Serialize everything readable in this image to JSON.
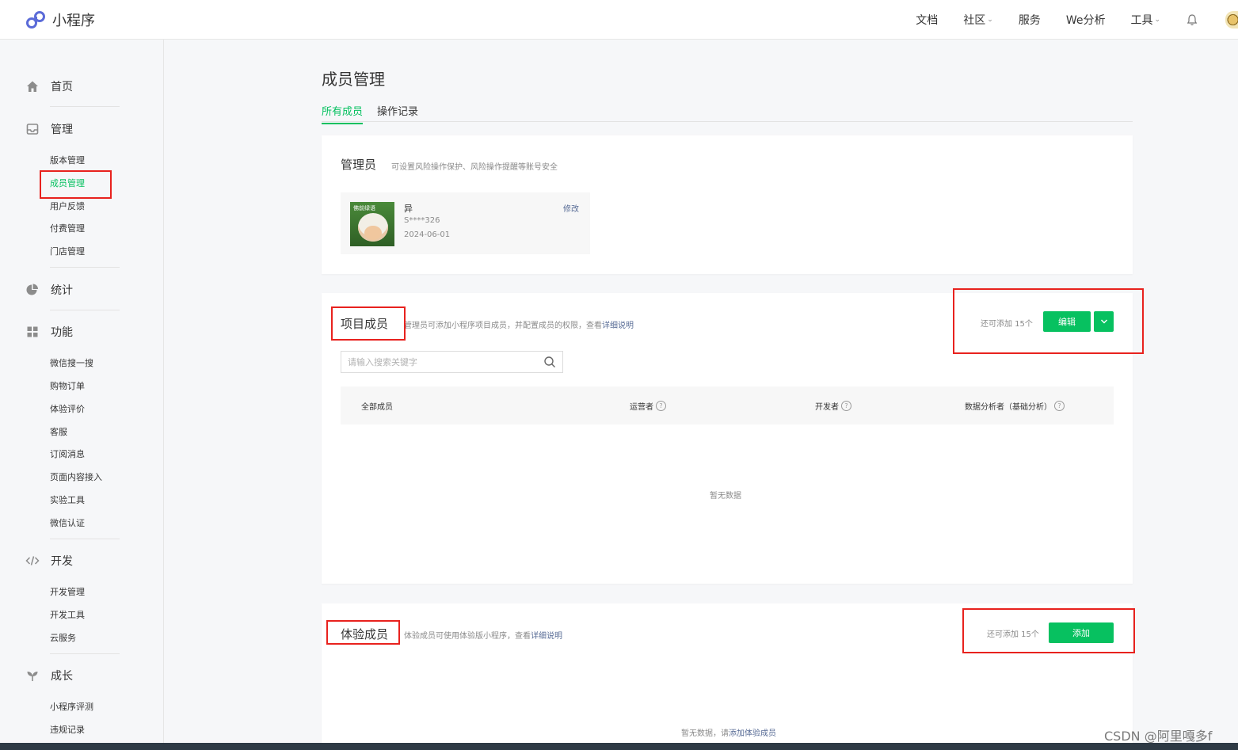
{
  "app": {
    "logo_text": "小程序"
  },
  "topnav": {
    "items": [
      {
        "label": "文档",
        "dropdown": false
      },
      {
        "label": "社区",
        "dropdown": true
      },
      {
        "label": "服务",
        "dropdown": false
      },
      {
        "label": "We分析",
        "dropdown": false
      },
      {
        "label": "工具",
        "dropdown": true
      }
    ],
    "chevron": "⌄"
  },
  "sidebar": {
    "home": "首页",
    "manage": "管理",
    "manage_items": [
      "版本管理",
      "成员管理",
      "用户反馈",
      "付费管理",
      "门店管理"
    ],
    "stats": "统计",
    "features": "功能",
    "feature_items": [
      "微信搜一搜",
      "购物订单",
      "体验评价",
      "客服",
      "订阅消息",
      "页面内容接入",
      "实验工具",
      "微信认证"
    ],
    "develop": "开发",
    "develop_items": [
      "开发管理",
      "开发工具",
      "云服务"
    ],
    "growth": "成长",
    "growth_items": [
      "小程序评测",
      "违规记录"
    ]
  },
  "page": {
    "title": "成员管理",
    "tabs": [
      "所有成员",
      "操作记录"
    ]
  },
  "admin_card": {
    "title": "管理员",
    "desc": "可设置风险操作保护、风险操作提醒等账号安全",
    "admin": {
      "name": "异",
      "id": "S****326",
      "date": "2024-06-01",
      "edit": "修改",
      "avatar_stamp": "佛前绿语"
    }
  },
  "project_card": {
    "title": "项目成员",
    "desc": "管理员可添加小程序项目成员，并配置成员的权限，查看",
    "desc_link": "详细说明",
    "remaining": "还可添加 15个",
    "edit_button": "编辑",
    "search_placeholder": "请输入搜索关键字",
    "columns": [
      "全部成员",
      "运营者",
      "开发者",
      "数据分析者（基础分析）"
    ],
    "help_glyph": "?",
    "empty": "暂无数据"
  },
  "trial_card": {
    "title": "体验成员",
    "desc": "体验成员可使用体验版小程序，查看",
    "desc_link": "详细说明",
    "remaining": "还可添加 15个",
    "add_button": "添加",
    "empty_prefix": "暂无数据，请",
    "empty_link": "添加体验成员"
  },
  "watermark": "CSDN @阿里嘎多f",
  "colors": {
    "accent": "#07c160",
    "link": "#576b95",
    "highlight_box": "#e8221e"
  }
}
